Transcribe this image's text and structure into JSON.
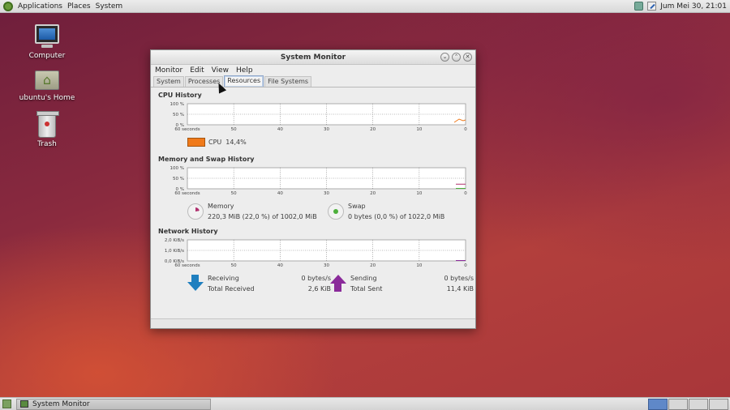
{
  "top_panel": {
    "menus": [
      "Applications",
      "Places",
      "System"
    ],
    "clock": "Jum Mei 30, 21:01"
  },
  "desktop_icons": [
    {
      "label": "Computer",
      "icon": "computer-icon"
    },
    {
      "label": "ubuntu's Home",
      "icon": "home-folder-icon"
    },
    {
      "label": "Trash",
      "icon": "trash-icon"
    }
  ],
  "window": {
    "title": "System Monitor",
    "menu": [
      "Monitor",
      "Edit",
      "View",
      "Help"
    ],
    "tabs": [
      {
        "label": "System",
        "active": false
      },
      {
        "label": "Processes",
        "active": false
      },
      {
        "label": "Resources",
        "active": true
      },
      {
        "label": "File Systems",
        "active": false
      }
    ],
    "x_ticks": [
      "60 seconds",
      "50",
      "40",
      "30",
      "20",
      "10",
      "0"
    ],
    "cpu": {
      "title": "CPU History",
      "y_ticks": [
        "100 %",
        "50 %",
        "0 %"
      ],
      "label": "CPU",
      "value": "14,4%",
      "color": "#f07a1a"
    },
    "memory": {
      "title": "Memory and Swap History",
      "y_ticks": [
        "100 %",
        "50 %",
        "0 %"
      ],
      "memory_label": "Memory",
      "memory_value": "220,3 MiB (22,0 %) of 1002,0 MiB",
      "swap_label": "Swap",
      "swap_value": "0 bytes (0,0 %) of 1022,0 MiB",
      "memory_color": "#b0306e",
      "swap_color": "#4caf3a"
    },
    "network": {
      "title": "Network History",
      "y_ticks": [
        "2,0 KiB/s",
        "1,0 KiB/s",
        "0,0 KiB/s"
      ],
      "receiving_label": "Receiving",
      "receiving_value": "0 bytes/s",
      "total_received_label": "Total Received",
      "total_received_value": "2,6 KiB",
      "sending_label": "Sending",
      "sending_value": "0 bytes/s",
      "total_sent_label": "Total Sent",
      "total_sent_value": "11,4 KiB",
      "receiving_color": "#1f7fbf",
      "sending_color": "#8a2a9a"
    }
  },
  "bottom_panel": {
    "task": "System Monitor",
    "workspaces": 4,
    "active_workspace": 1
  }
}
